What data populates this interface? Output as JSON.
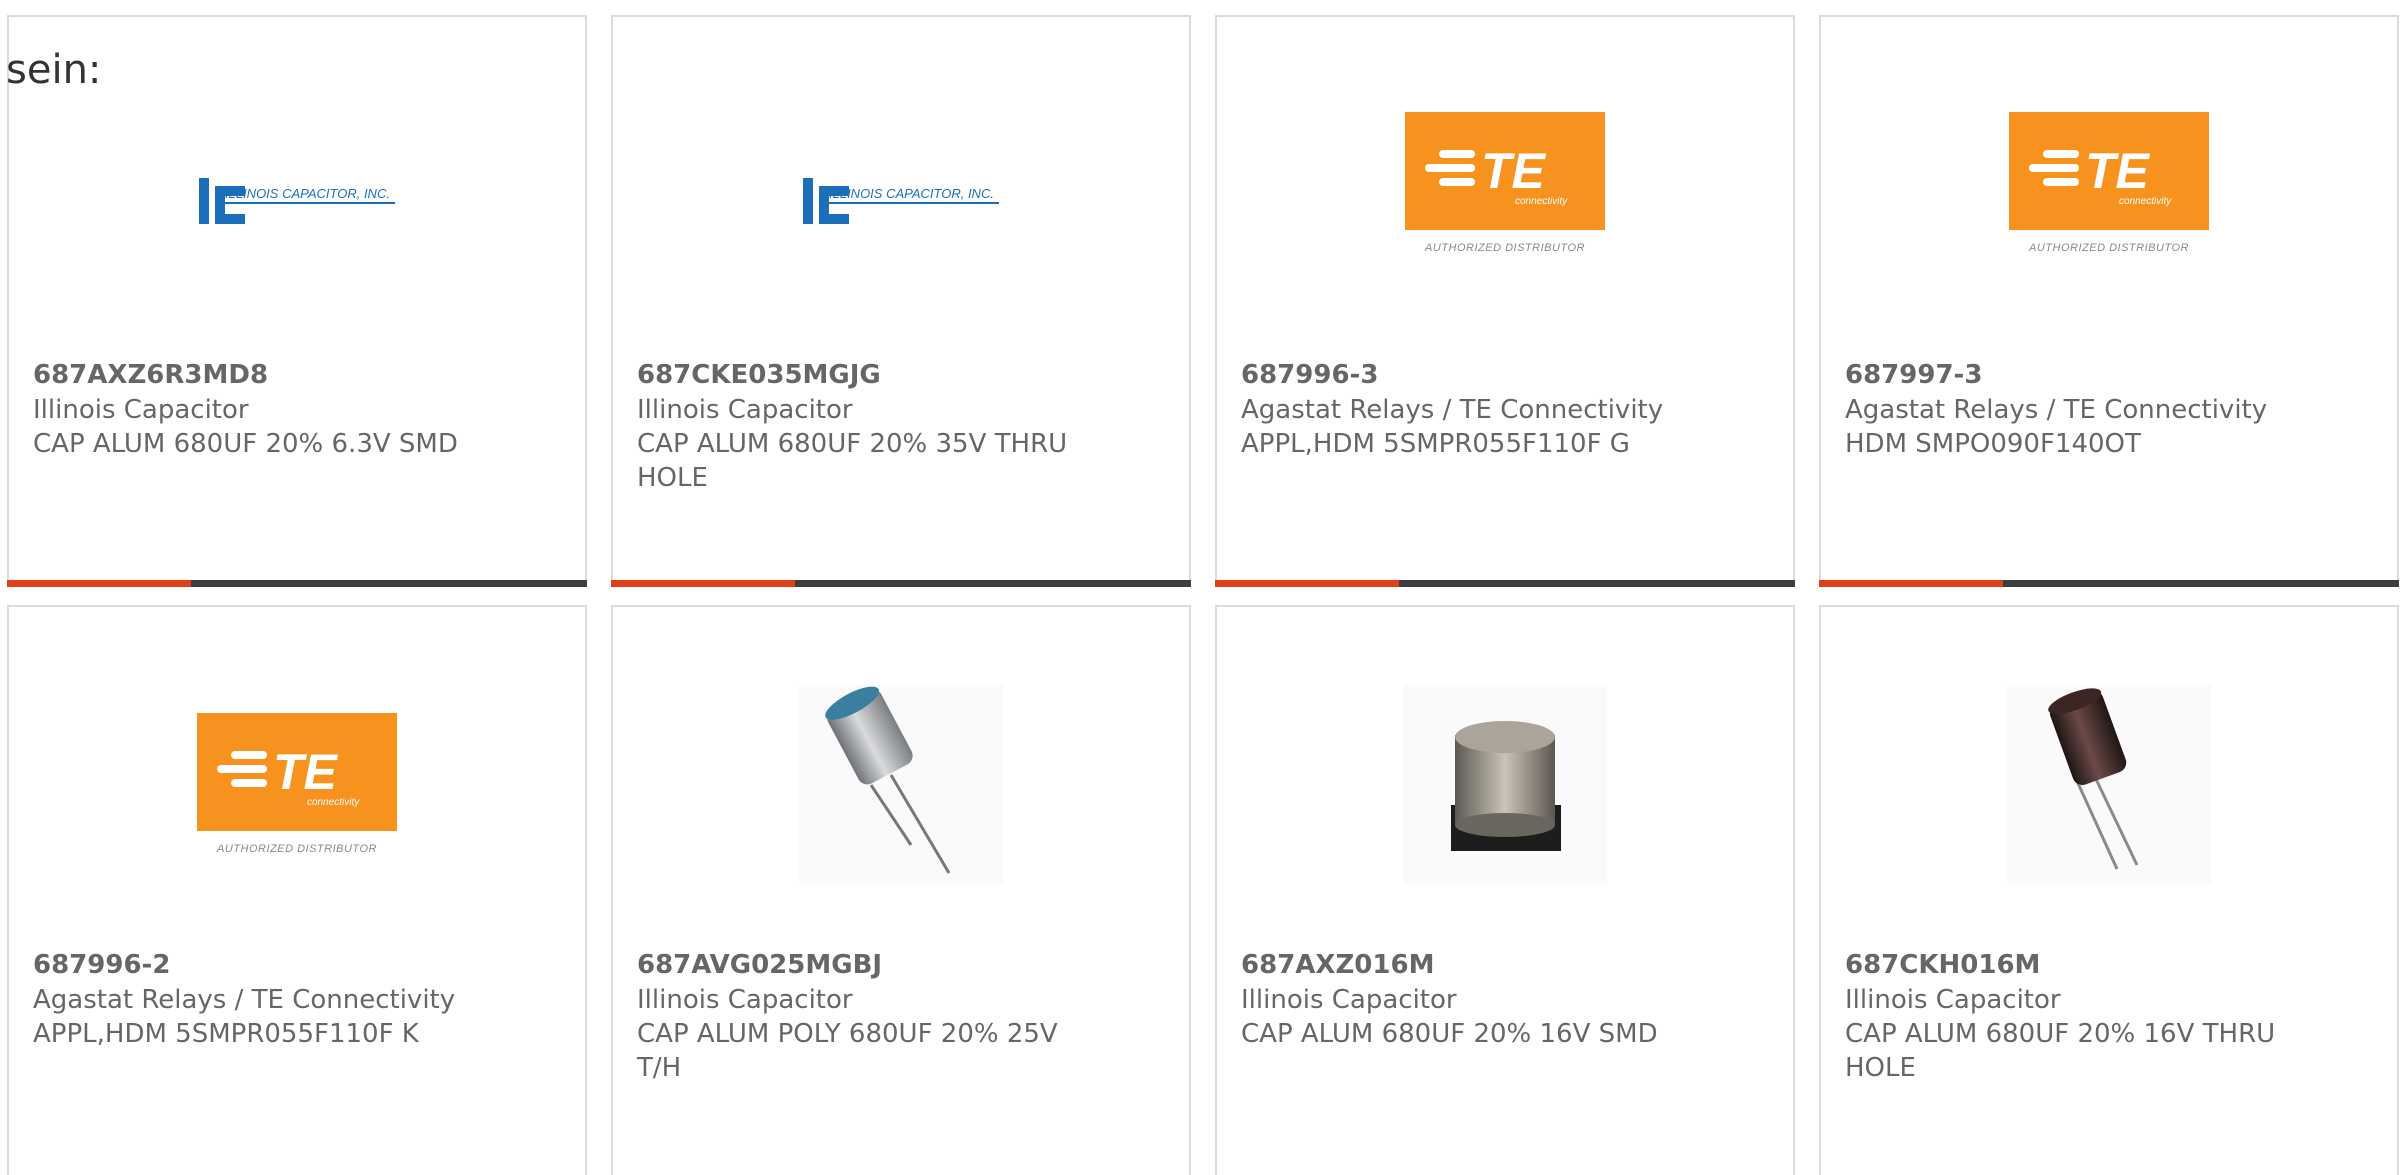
{
  "intro_text": "sein:",
  "products": [
    {
      "part_number": "687AXZ6R3MD8",
      "manufacturer": "Illinois Capacitor",
      "description": "CAP ALUM 680UF 20% 6.3V SMD",
      "image": "illinois-capacitor-logo",
      "logo_text": "ILLINOIS CAPACITOR, INC."
    },
    {
      "part_number": "687CKE035MGJG",
      "manufacturer": "Illinois Capacitor",
      "description": "CAP ALUM 680UF 20% 35V THRU HOLE",
      "image": "illinois-capacitor-logo",
      "logo_text": "ILLINOIS CAPACITOR, INC."
    },
    {
      "part_number": "687996-3",
      "manufacturer": "Agastat Relays / TE Connectivity",
      "description": "APPL,HDM 5SMPR055F110F G",
      "image": "te-connectivity-logo",
      "logo_text": "TE",
      "logo_subtext": "connectivity",
      "logo_caption": "AUTHORIZED DISTRIBUTOR"
    },
    {
      "part_number": "687997-3",
      "manufacturer": "Agastat Relays / TE Connectivity",
      "description": "HDM SMPO090F140OT",
      "image": "te-connectivity-logo",
      "logo_text": "TE",
      "logo_subtext": "connectivity",
      "logo_caption": "AUTHORIZED DISTRIBUTOR"
    },
    {
      "part_number": "687996-2",
      "manufacturer": "Agastat Relays / TE Connectivity",
      "description": "APPL,HDM 5SMPR055F110F K",
      "image": "te-connectivity-logo",
      "logo_text": "TE",
      "logo_subtext": "connectivity",
      "logo_caption": "AUTHORIZED DISTRIBUTOR"
    },
    {
      "part_number": "687AVG025MGBJ",
      "manufacturer": "Illinois Capacitor",
      "description": "CAP ALUM POLY 680UF 20% 25V T/H",
      "image": "radial-polymer-capacitor-photo"
    },
    {
      "part_number": "687AXZ016M",
      "manufacturer": "Illinois Capacitor",
      "description": "CAP ALUM 680UF 20% 16V SMD",
      "image": "smd-capacitor-photo"
    },
    {
      "part_number": "687CKH016M",
      "manufacturer": "Illinois Capacitor",
      "description": "CAP ALUM 680UF 20% 16V THRU HOLE",
      "image": "radial-electrolytic-capacitor-photo"
    }
  ],
  "colors": {
    "accent_bar": "#e03f1a",
    "bar_dark": "#3e3e3e",
    "te_orange": "#f7921e",
    "ic_blue": "#1b6fb8",
    "text": "#666666"
  }
}
